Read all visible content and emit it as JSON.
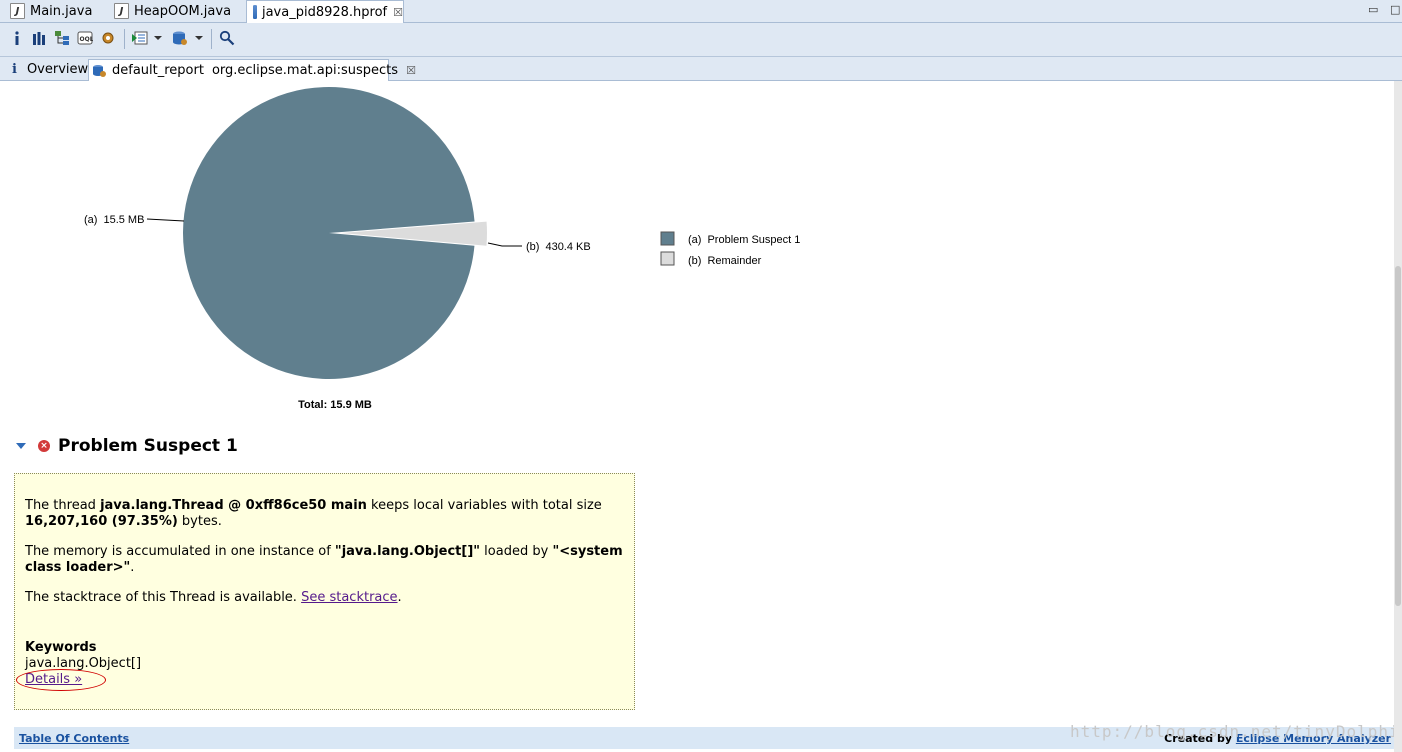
{
  "editor_tabs": [
    {
      "label": "Main.java"
    },
    {
      "label": "HeapOOM.java"
    },
    {
      "label": "java_pid8928.hprof",
      "close": "☒"
    }
  ],
  "sub_tabs": {
    "overview": "Overview",
    "report_name": "default_report",
    "report_id": "org.eclipse.mat.api:suspects",
    "close": "☒"
  },
  "chart_data": {
    "type": "pie",
    "slices": [
      {
        "letter": "(a)",
        "label": "Problem Suspect 1",
        "value_text": "15.5 MB",
        "value_mb": 15.5,
        "color": "#607f8e"
      },
      {
        "letter": "(b)",
        "label": "Remainder",
        "value_text": "430.4 KB",
        "value_mb": 0.42,
        "color": "#dcdcdc"
      }
    ],
    "total": "Total: 15.9 MB",
    "legend": "right"
  },
  "suspect": {
    "title": "Problem Suspect 1",
    "p1_pre": "The thread ",
    "p1_thread": "java.lang.Thread @ 0xff86ce50 main",
    "p1_mid": " keeps local variables with total size ",
    "p1_size": "16,207,160 (97.35%)",
    "p1_post": " bytes.",
    "p2_pre": "The memory is accumulated in one instance of ",
    "p2_class": "\"java.lang.Object[]\"",
    "p2_mid": " loaded by ",
    "p2_loader": "\"<system class loader>\"",
    "p2_post": ".",
    "p3_pre": "The stacktrace of this Thread is available. ",
    "p3_link": "See stacktrace",
    "p3_post": ".",
    "keywords_label": "Keywords",
    "keyword": "java.lang.Object[]",
    "details": "Details »"
  },
  "footer": {
    "toc": "Table Of Contents",
    "created_by": "Created by ",
    "created_link": "Eclipse Memory Analyzer"
  },
  "watermark": "http://blog.csdn.net/tinyDolphin"
}
